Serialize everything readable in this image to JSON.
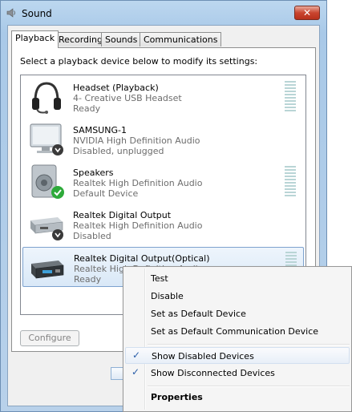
{
  "window": {
    "title": "Sound",
    "close_symbol": "✕"
  },
  "tabs": [
    {
      "label": "Playback",
      "active": true
    },
    {
      "label": "Recording",
      "active": false
    },
    {
      "label": "Sounds",
      "active": false
    },
    {
      "label": "Communications",
      "active": false
    }
  ],
  "panel": {
    "instruction": "Select a playback device below to modify its settings:"
  },
  "devices": [
    {
      "name": "Headset (Playback)",
      "desc": "4- Creative USB Headset",
      "status": "Ready",
      "icon": "headset-icon",
      "meter": true
    },
    {
      "name": "SAMSUNG-1",
      "desc": "NVIDIA High Definition Audio",
      "status": "Disabled, unplugged",
      "icon": "monitor-icon",
      "badge": "down-arrow",
      "meter": false
    },
    {
      "name": "Speakers",
      "desc": "Realtek High Definition Audio",
      "status": "Default Device",
      "icon": "speaker-icon",
      "badge": "checkmark",
      "meter": true
    },
    {
      "name": "Realtek Digital Output",
      "desc": "Realtek High Definition Audio",
      "status": "Disabled",
      "icon": "digital-output-icon",
      "badge": "down-arrow",
      "meter": false
    },
    {
      "name": "Realtek Digital Output(Optical)",
      "desc": "Realtek High Definition Audio",
      "status": "Ready",
      "icon": "optical-output-icon",
      "meter": true,
      "selected": true
    }
  ],
  "buttons": {
    "configure": "Configure"
  },
  "context_menu": {
    "items": [
      {
        "label": "Test"
      },
      {
        "label": "Disable"
      },
      {
        "label": "Set as Default Device"
      },
      {
        "label": "Set as Default Communication Device"
      },
      {
        "label": "Show Disabled Devices",
        "checked": true
      },
      {
        "label": "Show Disconnected Devices",
        "checked": true
      },
      {
        "label": "Properties",
        "bold": true
      }
    ],
    "check_symbol": "✓"
  },
  "colors": {
    "accent": "#2a5ea8",
    "selection": "#d9e8f7",
    "meter": "#b9d5d6"
  }
}
